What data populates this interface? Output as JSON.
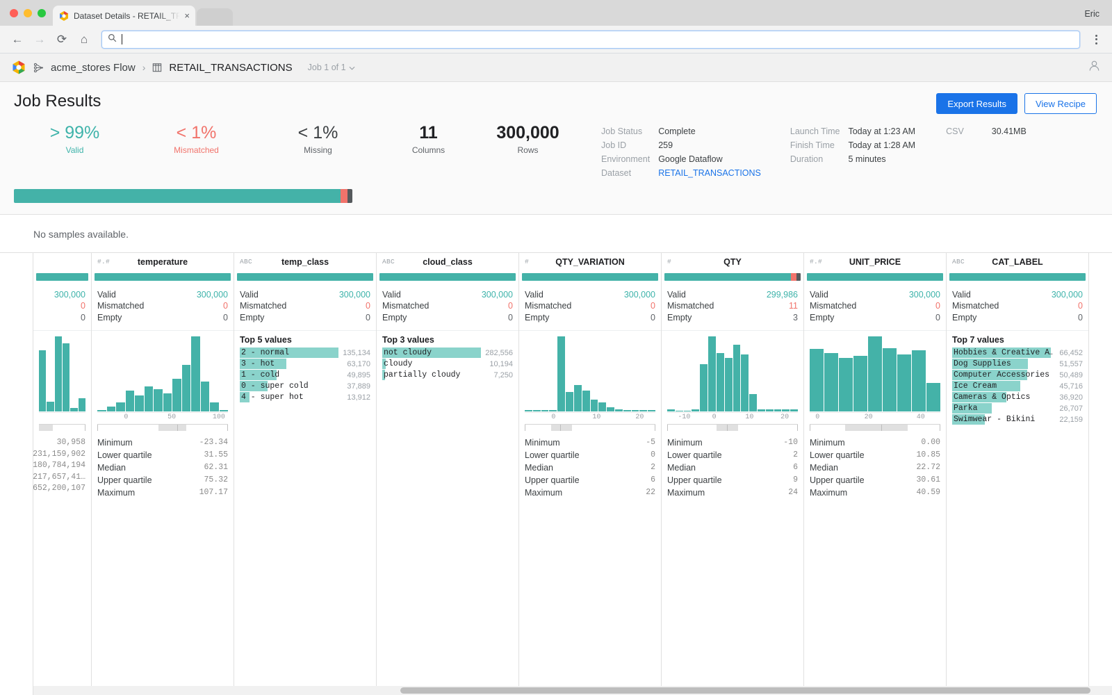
{
  "browser": {
    "tab_title": "Dataset Details - RETAIL_TRAN",
    "tab_close": "×",
    "profile_name": "Eric",
    "omnibox_value": "",
    "back_icon": "←",
    "forward_icon": "→",
    "reload_icon": "⟳",
    "home_icon": "⌂"
  },
  "app_header": {
    "flow_name": "acme_stores Flow",
    "separator": "›",
    "dataset_name": "RETAIL_TRANSACTIONS",
    "job_selector": "Job 1 of 1",
    "chevron": "⌄"
  },
  "results": {
    "title": "Job Results",
    "export_label": "Export Results",
    "recipe_label": "View Recipe",
    "stats": [
      {
        "value": "> 99%",
        "label": "Valid",
        "kind": "valid"
      },
      {
        "value": "< 1%",
        "label": "Mismatched",
        "kind": "mismatched"
      },
      {
        "value": "< 1%",
        "label": "Missing",
        "kind": "missing"
      }
    ],
    "counts": [
      {
        "value": "11",
        "label": "Columns"
      },
      {
        "value": "300,000",
        "label": "Rows"
      }
    ],
    "meta_left": {
      "keys": [
        "Job Status",
        "Job ID",
        "Environment",
        "Dataset"
      ],
      "values": [
        "Complete",
        "259",
        "Google Dataflow",
        "RETAIL_TRANSACTIONS"
      ]
    },
    "meta_mid": {
      "keys": [
        "Launch Time",
        "Finish Time",
        "Duration"
      ],
      "values": [
        "Today at 1:23 AM",
        "Today at 1:28 AM",
        "5 minutes"
      ]
    },
    "meta_right": {
      "keys": [
        "CSV"
      ],
      "values": [
        "30.41MB"
      ]
    },
    "quality": {
      "valid_pct": 96.5,
      "mismatch_pct": 2.0,
      "missing_pct": 1.5
    }
  },
  "samples_note": "No samples available.",
  "chart_data": {
    "type": "table",
    "title": "Column profile summary",
    "columns": [
      {
        "name": "",
        "type_icon": "",
        "clipped": true,
        "quality": {
          "valid_pct": 100,
          "mismatch_pct": 0,
          "missing_pct": 0
        },
        "counts": [
          {
            "label": "",
            "value": "300,000",
            "kind": "valid"
          },
          {
            "label": "",
            "value": "0",
            "kind": "mismatched"
          },
          {
            "label": "",
            "value": "0",
            "kind": "empty"
          }
        ],
        "histogram": {
          "values": [
            18,
            3,
            22,
            20,
            1,
            4
          ],
          "ticks": []
        },
        "stats": [
          {
            "label": "",
            "value": "30,958"
          },
          {
            "label": "",
            "value": "231,159,902"
          },
          {
            "label": "",
            "value": "180,784,194"
          },
          {
            "label": "",
            "value": "217,657,41…"
          },
          {
            "label": "",
            "value": "652,200,107"
          }
        ]
      },
      {
        "name": "temperature",
        "type_icon": "#.#",
        "clipped": false,
        "quality": {
          "valid_pct": 100,
          "mismatch_pct": 0,
          "missing_pct": 0
        },
        "counts": [
          {
            "label": "Valid",
            "value": "300,000",
            "kind": "valid"
          },
          {
            "label": "Mismatched",
            "value": "0",
            "kind": "mismatched"
          },
          {
            "label": "Empty",
            "value": "0",
            "kind": "empty"
          }
        ],
        "histogram": {
          "values": [
            2,
            7,
            12,
            28,
            22,
            34,
            30,
            24,
            44,
            62,
            100,
            40,
            12,
            2
          ],
          "ticks": [
            {
              "label": "0",
              "pos": 22
            },
            {
              "label": "50",
              "pos": 57
            },
            {
              "label": "100",
              "pos": 93
            }
          ]
        },
        "range": {
          "q1": 47,
          "median": 61,
          "q3": 68
        },
        "stats": [
          {
            "label": "Minimum",
            "value": "-23.34"
          },
          {
            "label": "Lower quartile",
            "value": "31.55"
          },
          {
            "label": "Median",
            "value": "62.31"
          },
          {
            "label": "Upper quartile",
            "value": "75.32"
          },
          {
            "label": "Maximum",
            "value": "107.17"
          }
        ]
      },
      {
        "name": "temp_class",
        "type_icon": "ABC",
        "clipped": false,
        "quality": {
          "valid_pct": 100,
          "mismatch_pct": 0,
          "missing_pct": 0
        },
        "counts": [
          {
            "label": "Valid",
            "value": "300,000",
            "kind": "valid"
          },
          {
            "label": "Mismatched",
            "value": "0",
            "kind": "mismatched"
          },
          {
            "label": "Empty",
            "value": "0",
            "kind": "empty"
          }
        ],
        "top_values_title": "Top 5 values",
        "top_values": [
          {
            "label": "2 - normal",
            "count": "135,134",
            "pct": 100
          },
          {
            "label": "3 - hot",
            "count": "63,170",
            "pct": 47
          },
          {
            "label": "1 - cold",
            "count": "49,895",
            "pct": 37
          },
          {
            "label": "0 - super cold",
            "count": "37,889",
            "pct": 28
          },
          {
            "label": "4 - super hot",
            "count": "13,912",
            "pct": 10
          }
        ]
      },
      {
        "name": "cloud_class",
        "type_icon": "ABC",
        "clipped": false,
        "quality": {
          "valid_pct": 100,
          "mismatch_pct": 0,
          "missing_pct": 0
        },
        "counts": [
          {
            "label": "Valid",
            "value": "300,000",
            "kind": "valid"
          },
          {
            "label": "Mismatched",
            "value": "0",
            "kind": "mismatched"
          },
          {
            "label": "Empty",
            "value": "0",
            "kind": "empty"
          }
        ],
        "top_values_title": "Top 3 values",
        "top_values": [
          {
            "label": "not cloudy",
            "count": "282,556",
            "pct": 100
          },
          {
            "label": "cloudy",
            "count": "10,194",
            "pct": 3.6
          },
          {
            "label": "partially cloudy",
            "count": "7,250",
            "pct": 2.6
          }
        ]
      },
      {
        "name": "QTY_VARIATION",
        "type_icon": "#",
        "clipped": false,
        "quality": {
          "valid_pct": 100,
          "mismatch_pct": 0,
          "missing_pct": 0
        },
        "counts": [
          {
            "label": "Valid",
            "value": "300,000",
            "kind": "valid"
          },
          {
            "label": "Mismatched",
            "value": "0",
            "kind": "mismatched"
          },
          {
            "label": "Empty",
            "value": "0",
            "kind": "empty"
          }
        ],
        "histogram": {
          "values": [
            2,
            2,
            2,
            2,
            100,
            26,
            36,
            28,
            16,
            12,
            6,
            3,
            2,
            2,
            2,
            2
          ],
          "ticks": [
            {
              "label": "0",
              "pos": 22
            },
            {
              "label": "10",
              "pos": 55
            },
            {
              "label": "20",
              "pos": 88
            }
          ]
        },
        "range": {
          "q1": 20,
          "median": 27,
          "q3": 36
        },
        "stats": [
          {
            "label": "Minimum",
            "value": "-5"
          },
          {
            "label": "Lower quartile",
            "value": "0"
          },
          {
            "label": "Median",
            "value": "2"
          },
          {
            "label": "Upper quartile",
            "value": "6"
          },
          {
            "label": "Maximum",
            "value": "22"
          }
        ]
      },
      {
        "name": "QTY",
        "type_icon": "#",
        "clipped": false,
        "quality": {
          "valid_pct": 93,
          "mismatch_pct": 4,
          "missing_pct": 3
        },
        "counts": [
          {
            "label": "Valid",
            "value": "299,986",
            "kind": "valid"
          },
          {
            "label": "Mismatched",
            "value": "11",
            "kind": "mismatched"
          },
          {
            "label": "Empty",
            "value": "3",
            "kind": "empty"
          }
        ],
        "histogram": {
          "values": [
            3,
            1,
            1,
            3,
            58,
            92,
            72,
            66,
            82,
            70,
            22,
            3,
            3,
            3,
            3,
            3
          ],
          "ticks": [
            {
              "label": "-10",
              "pos": 13
            },
            {
              "label": "0",
              "pos": 36
            },
            {
              "label": "10",
              "pos": 63
            },
            {
              "label": "20",
              "pos": 90
            }
          ]
        },
        "range": {
          "q1": 38,
          "median": 46,
          "q3": 54
        },
        "stats": [
          {
            "label": "Minimum",
            "value": "-10"
          },
          {
            "label": "Lower quartile",
            "value": "2"
          },
          {
            "label": "Median",
            "value": "6"
          },
          {
            "label": "Upper quartile",
            "value": "9"
          },
          {
            "label": "Maximum",
            "value": "24"
          }
        ]
      },
      {
        "name": "UNIT_PRICE",
        "type_icon": "#.#",
        "clipped": false,
        "quality": {
          "valid_pct": 100,
          "mismatch_pct": 0,
          "missing_pct": 0
        },
        "counts": [
          {
            "label": "Valid",
            "value": "300,000",
            "kind": "valid"
          },
          {
            "label": "Mismatched",
            "value": "0",
            "kind": "mismatched"
          },
          {
            "label": "Empty",
            "value": "0",
            "kind": "empty"
          }
        ],
        "histogram": {
          "values": [
            84,
            78,
            72,
            74,
            100,
            85,
            76,
            82,
            38
          ],
          "ticks": [
            {
              "label": "0",
              "pos": 6
            },
            {
              "label": "20",
              "pos": 45
            },
            {
              "label": "40",
              "pos": 85
            }
          ]
        },
        "range": {
          "q1": 27,
          "median": 55,
          "q3": 75
        },
        "stats": [
          {
            "label": "Minimum",
            "value": "0.00"
          },
          {
            "label": "Lower quartile",
            "value": "10.85"
          },
          {
            "label": "Median",
            "value": "22.72"
          },
          {
            "label": "Upper quartile",
            "value": "30.61"
          },
          {
            "label": "Maximum",
            "value": "40.59"
          }
        ]
      },
      {
        "name": "CAT_LABEL",
        "type_icon": "ABC",
        "clipped": false,
        "quality": {
          "valid_pct": 100,
          "mismatch_pct": 0,
          "missing_pct": 0
        },
        "counts": [
          {
            "label": "Valid",
            "value": "300,000",
            "kind": "valid"
          },
          {
            "label": "Mismatched",
            "value": "0",
            "kind": "mismatched"
          },
          {
            "label": "Empty",
            "value": "0",
            "kind": "empty"
          }
        ],
        "top_values_title": "Top 7 values",
        "top_values": [
          {
            "label": "Hobbies & Creative A…",
            "count": "66,452",
            "pct": 100
          },
          {
            "label": "Dog Supplies",
            "count": "51,557",
            "pct": 77
          },
          {
            "label": "Computer Accessories",
            "count": "50,489",
            "pct": 76
          },
          {
            "label": "Ice Cream",
            "count": "45,716",
            "pct": 69
          },
          {
            "label": "Cameras & Optics",
            "count": "36,920",
            "pct": 55
          },
          {
            "label": "Parka",
            "count": "26,707",
            "pct": 40
          },
          {
            "label": "Swimwear - Bikini",
            "count": "22,159",
            "pct": 33
          }
        ]
      }
    ]
  },
  "colors": {
    "teal": "#44b2a8",
    "teal_light": "#8ad3cb",
    "salmon": "#f1736b",
    "blue": "#1a73e8",
    "dark": "#55595c"
  }
}
